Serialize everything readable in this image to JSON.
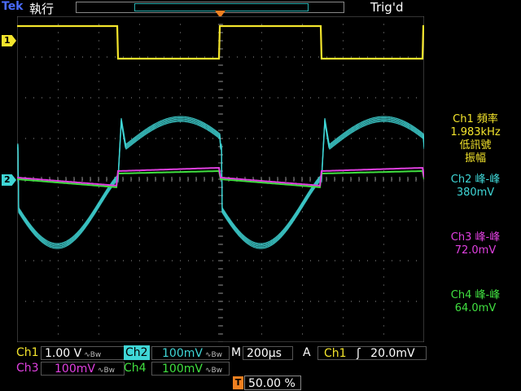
{
  "header": {
    "brand": "Tek",
    "acq_state": "執行",
    "trigger_status": "Trig'd"
  },
  "markers": {
    "ch1": "1",
    "ch2": "2",
    "trigger": "T",
    "trigger_level_glyph": "◂"
  },
  "measurements": {
    "ch1": {
      "line1": "Ch1 頻率",
      "line2": "1.983kHz",
      "line3": "低訊號",
      "line4": "振幅"
    },
    "ch2": {
      "line1": "Ch2 峰-峰",
      "line2": "380mV"
    },
    "ch3": {
      "line1": "Ch3 峰-峰",
      "line2": "72.0mV"
    },
    "ch4": {
      "line1": "Ch4 峰-峰",
      "line2": "64.0mV"
    }
  },
  "channels": {
    "ch1": {
      "label": "Ch1",
      "scale": "1.00 V",
      "bw": "∿Bw",
      "color": "#f4e52c"
    },
    "ch2": {
      "label": "Ch2",
      "scale": "100mV",
      "bw": "∿Bw",
      "color": "#3fd6d6"
    },
    "ch3": {
      "label": "Ch3",
      "scale": "100mV",
      "bw": "∿Bw",
      "color": "#e040e0"
    },
    "ch4": {
      "label": "Ch4",
      "scale": "100mV",
      "bw": "∿Bw",
      "color": "#40e040"
    }
  },
  "timebase": {
    "label": "M",
    "value": "200µs"
  },
  "trigger": {
    "mode": "A",
    "source": "Ch1",
    "slope": "ʃ",
    "level": "20.0mV",
    "position": "50.00 %",
    "badge": "T"
  }
}
